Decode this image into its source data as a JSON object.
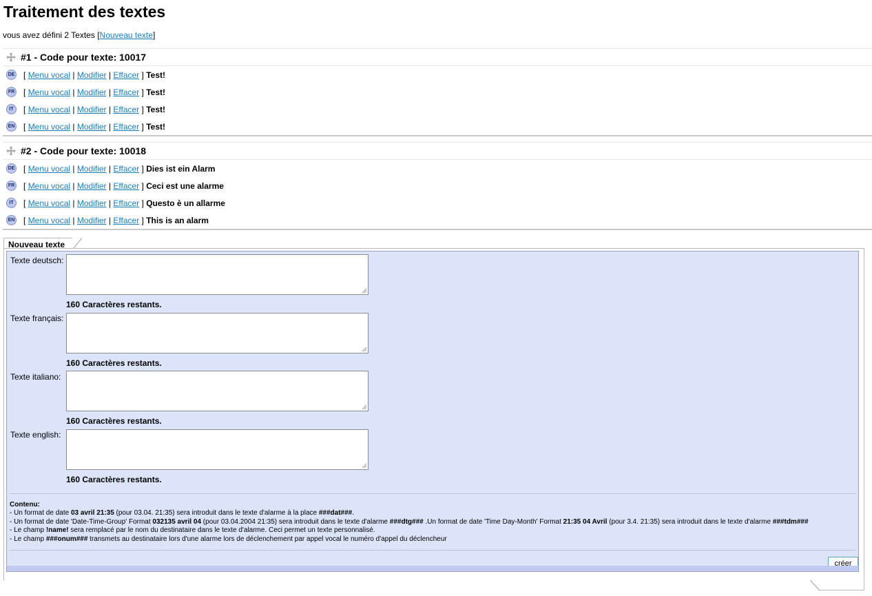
{
  "page_title": "Traitement des textes",
  "summary": {
    "text": "vous avez défini 2 Textes",
    "open": "[",
    "new_link": "Nouveau texte",
    "close": "]"
  },
  "actions": {
    "open": "[",
    "sep": "|",
    "close": "]",
    "menu_vocal": "Menu vocal",
    "modifier": "Modifier",
    "effacer": "Effacer"
  },
  "codes": [
    {
      "title": "#1 - Code pour texte: 10017",
      "rows": [
        {
          "lang": "DE",
          "text": "Test!"
        },
        {
          "lang": "FR",
          "text": "Test!"
        },
        {
          "lang": "IT",
          "text": "Test!"
        },
        {
          "lang": "EN",
          "text": "Test!"
        }
      ]
    },
    {
      "title": "#2 - Code pour texte: 10018",
      "rows": [
        {
          "lang": "DE",
          "text": "Dies ist ein Alarm"
        },
        {
          "lang": "FR",
          "text": "Ceci est une alarme"
        },
        {
          "lang": "IT",
          "text": "Questo è un allarme"
        },
        {
          "lang": "EN",
          "text": "This is an alarm"
        }
      ]
    }
  ],
  "form": {
    "tab_label": "Nouveau texte",
    "fields": [
      {
        "label": "Texte deutsch:",
        "value": "",
        "remaining": "160 Caractères restants."
      },
      {
        "label": "Texte français:",
        "value": "",
        "remaining": "160 Caractères restants."
      },
      {
        "label": "Texte italiano:",
        "value": "",
        "remaining": "160 Caractères restants."
      },
      {
        "label": "Texte english:",
        "value": "",
        "remaining": "160 Caractères restants."
      }
    ],
    "notes": {
      "heading": "Contenu:",
      "l1_a": "- Un format de date ",
      "l1_b": "03 avril 21:35",
      "l1_c": " (pour 03.04. 21:35) sera introduit dans le texte d'alarme à la place ",
      "l1_d": "###dat###",
      "l1_e": ".",
      "l2_a": "- Un format de date 'Date-Time-Group' Format ",
      "l2_b": "032135 avril 04",
      "l2_c": " (pour 03.04.2004 21:35) sera introduit dans le texte d'alarme ",
      "l2_d": "###dtg###",
      "l2_e": " .Un format de date 'Time Day-Month' Format ",
      "l2_f": "21:35 04 Avril",
      "l2_g": " (pour 3.4. 21:35) sera introduit dans le texte d'alarme ",
      "l2_h": "###tdm###",
      "l3_a": "- Le champ ",
      "l3_b": "!name!",
      "l3_c": " sera remplacé par le nom du destinataire dans le texte d'alarme. Ceci permet un texte personnalisé.",
      "l4_a": "- Le champ ",
      "l4_b": "###onum###",
      "l4_c": " transmets au destinataire lors d'une alarme lors de déclenchement par appel vocal le numéro d'appel du déclencheur"
    },
    "submit_label": "créer"
  },
  "colors": {
    "link": "#1a7fc0",
    "panel_bg": "#dce4fa",
    "badge_bg": "#bcc7ee"
  }
}
